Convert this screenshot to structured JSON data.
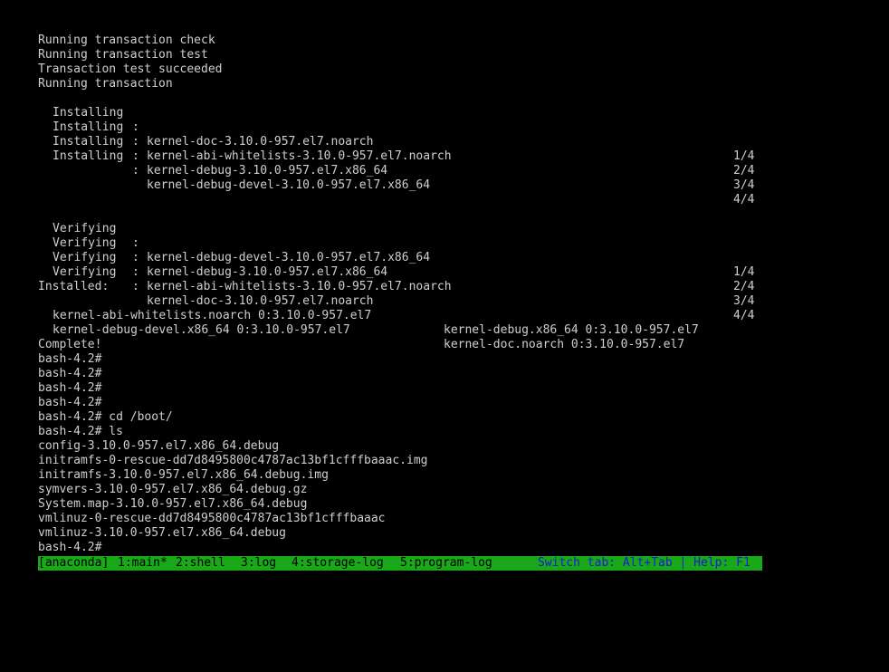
{
  "transaction": {
    "check": "Running transaction check",
    "test": "Running transaction test",
    "succeeded": "Transaction test succeeded",
    "running": "Running transaction",
    "separator": ":",
    "installing_label": "Installing",
    "verifying_label": "Verifying",
    "installing": [
      {
        "package": "kernel-doc-3.10.0-957.el7.noarch",
        "count": "1/4"
      },
      {
        "package": "kernel-abi-whitelists-3.10.0-957.el7.noarch",
        "count": "2/4"
      },
      {
        "package": "kernel-debug-3.10.0-957.el7.x86_64",
        "count": "3/4"
      },
      {
        "package": "kernel-debug-devel-3.10.0-957.el7.x86_64",
        "count": "4/4"
      }
    ],
    "verifying": [
      {
        "package": "kernel-debug-devel-3.10.0-957.el7.x86_64",
        "count": "1/4"
      },
      {
        "package": "kernel-debug-3.10.0-957.el7.x86_64",
        "count": "2/4"
      },
      {
        "package": "kernel-abi-whitelists-3.10.0-957.el7.noarch",
        "count": "3/4"
      },
      {
        "package": "kernel-doc-3.10.0-957.el7.noarch",
        "count": "4/4"
      }
    ]
  },
  "installed": {
    "header": "Installed:",
    "rows": [
      {
        "left": "kernel-abi-whitelists.noarch 0:3.10.0-957.el7",
        "right": "kernel-debug.x86_64 0:3.10.0-957.el7"
      },
      {
        "left": "kernel-debug-devel.x86_64 0:3.10.0-957.el7",
        "right": "kernel-doc.noarch 0:3.10.0-957.el7"
      }
    ]
  },
  "shell": {
    "complete": "Complete!",
    "prompt": "bash-4.2#",
    "cd_command": "bash-4.2# cd /boot/",
    "ls_command": "bash-4.2# ls",
    "ls_output": [
      "config-3.10.0-957.el7.x86_64.debug",
      "initramfs-0-rescue-dd7d8495800c4787ac13bf1cfffbaaac.img",
      "initramfs-3.10.0-957.el7.x86_64.debug.img",
      "symvers-3.10.0-957.el7.x86_64.debug.gz",
      "System.map-3.10.0-957.el7.x86_64.debug",
      "vmlinuz-0-rescue-dd7d8495800c4787ac13bf1cfffbaaac",
      "vmlinuz-3.10.0-957.el7.x86_64.debug"
    ],
    "final_prompt": "bash-4.2#"
  },
  "statusbar": {
    "session": "[anaconda]",
    "tabs": [
      "1:main*",
      "2:shell",
      "3:log",
      "4:storage-log",
      "5:program-log"
    ],
    "help": "Switch tab: Alt+Tab | Help: F1"
  },
  "colors": {
    "background": "#000000",
    "text": "#cfcfcf",
    "statusbar_bg": "#18a818",
    "statusbar_text": "#000000",
    "help_text": "#1a1ad8"
  }
}
